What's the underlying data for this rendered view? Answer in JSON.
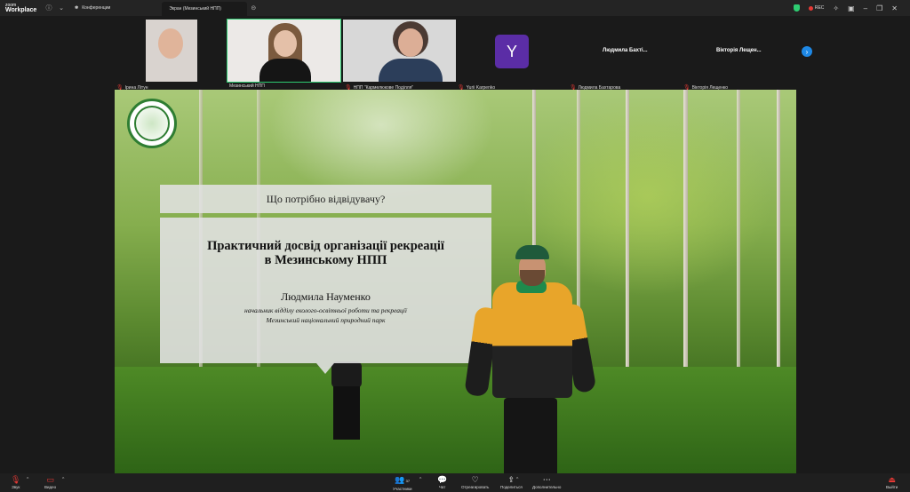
{
  "app": {
    "logo_top": "zoom",
    "logo_bottom": "Workplace"
  },
  "tabs": [
    {
      "label": "Конференции"
    },
    {
      "label": "Экран (Мезинський НПП)"
    }
  ],
  "status": {
    "rec": "REC"
  },
  "participants": [
    {
      "name": "Ірина Літун"
    },
    {
      "name": "Мезинський НПП"
    },
    {
      "name": "НПП \"Кармелюкове Поділля\""
    },
    {
      "name": "Yurii Karpenko",
      "initial": "Y",
      "avatar_color": "#5b2da6"
    },
    {
      "name": "Людмила Бахтарова",
      "tile_text": "Людмила Бахті..."
    },
    {
      "name": "Вікторія Лещенко",
      "tile_text": "Вікторія Лещен..."
    }
  ],
  "slide": {
    "question": "Що потрібно відвідувачу?",
    "title_line1": "Практичний досвід організації рекреації",
    "title_line2": "в Мезинському НПП",
    "speaker_name": "Людмила Науменко",
    "speaker_role1": "начальник відділу еколого-освітньої роботи та рекреації",
    "speaker_role2": "Мезинський національний природний парк"
  },
  "toolbar": {
    "audio": "Звук",
    "video": "Видео",
    "participants": "Участники",
    "participants_count": "37",
    "chat": "Чат",
    "react": "Отреагировать",
    "share": "Поделиться",
    "more": "Дополнительно",
    "leave": "Выйти"
  },
  "colors": {
    "active_speaker": "#2ecc71",
    "mic_off": "#e53935",
    "accent": "#1e88e5"
  }
}
